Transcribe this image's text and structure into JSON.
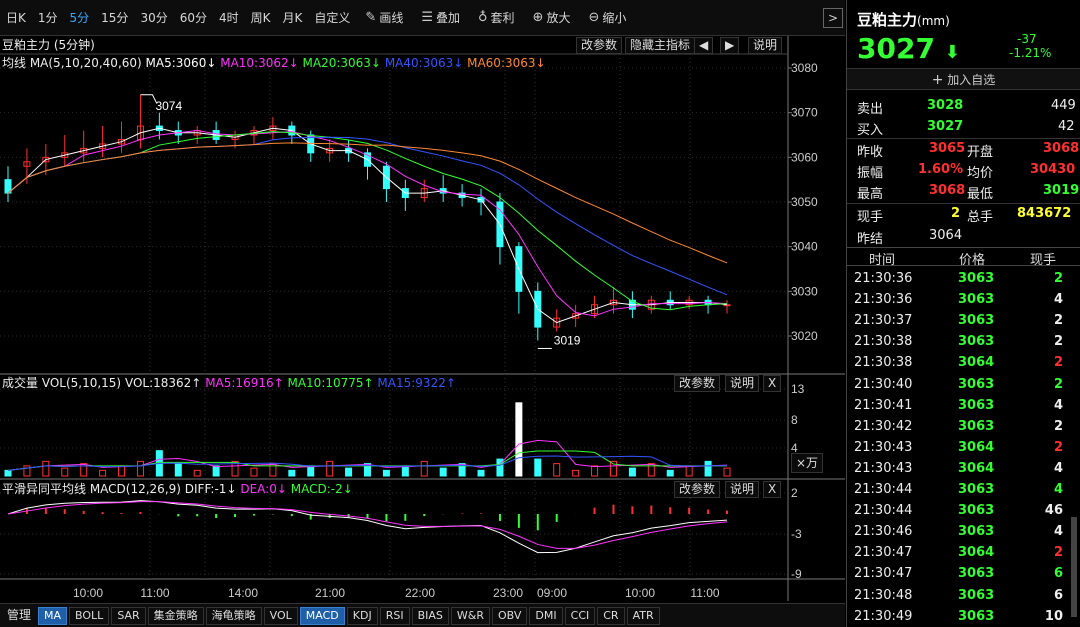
{
  "toolbar": {
    "items": [
      "日K",
      "1分",
      "5分",
      "15分",
      "30分",
      "60分",
      "4时",
      "周K",
      "月K",
      "自定义"
    ],
    "active": "5分",
    "tools": [
      {
        "icon": "pencil-icon",
        "label": "画线"
      },
      {
        "icon": "layers-icon",
        "label": "叠加"
      },
      {
        "icon": "moneybag-icon",
        "label": "套利"
      },
      {
        "icon": "zoom-in-icon",
        "label": "放大"
      },
      {
        "icon": "zoom-out-icon",
        "label": "缩小"
      }
    ],
    "more": ">"
  },
  "main_panel": {
    "title": "豆粕主力 (5分钟)",
    "btn_params": "改参数",
    "btn_hide": "隐藏主指标",
    "btn_left": "◀",
    "btn_right": "▶",
    "btn_help": "说明",
    "ma_label": "均线 MA(5,10,20,40,60)",
    "ma5": "MA5:3060↓",
    "ma10": "MA10:3062↓",
    "ma20": "MA20:3063↓",
    "ma40": "MA40:3063↓",
    "ma60": "MA60:3063↓",
    "high_label": "3074",
    "low_label": "3019"
  },
  "vol_panel": {
    "title": "成交量 VOL(5,10,15)",
    "vol": "VOL:18362↑",
    "ma5": "MA5:16916↑",
    "ma10": "MA10:10775↑",
    "ma15": "MA15:9322↑",
    "btn_params": "改参数",
    "btn_help": "说明",
    "btn_close": "X",
    "unit": "×万"
  },
  "macd_panel": {
    "title": "平滑异同平均线 MACD(12,26,9)",
    "diff": "DIFF:-1↓",
    "dea": "DEA:0↓",
    "macd": "MACD:-2↓",
    "btn_params": "改参数",
    "btn_help": "说明",
    "btn_close": "X"
  },
  "axes": {
    "price_ticks": [
      "3080",
      "3070",
      "3060",
      "3050",
      "3040",
      "3030",
      "3020"
    ],
    "vol_ticks": [
      "13",
      "8",
      "4"
    ],
    "macd_ticks": [
      "2",
      "-3",
      "-9"
    ],
    "time_labels": [
      "10:00",
      "11:00",
      "14:00",
      "21:00",
      "22:00",
      "23:00",
      "09:00",
      "10:00",
      "11:00"
    ]
  },
  "bottombar": {
    "items": [
      "管理",
      "MA",
      "BOLL",
      "SAR",
      "集金策略",
      "海龟策略",
      "VOL",
      "MACD",
      "KDJ",
      "RSI",
      "BIAS",
      "W&R",
      "OBV",
      "DMI",
      "CCI",
      "CR",
      "ATR"
    ],
    "active": [
      "MA",
      "MACD"
    ]
  },
  "quote": {
    "name": "豆粕主力",
    "unit": "(mm)",
    "price": "3027",
    "arrow": "⬇",
    "change": "-37",
    "change_pct": "-1.21%",
    "add_watch": "加入自选",
    "sell_label": "卖出",
    "sell_price": "3028",
    "sell_vol": "449",
    "buy_label": "买入",
    "buy_price": "3027",
    "buy_vol": "42",
    "prev_close_label": "昨收",
    "prev_close": "3065",
    "open_label": "开盘",
    "open": "3068",
    "amp_label": "振幅",
    "amp": "1.60%",
    "avg_label": "均价",
    "avg": "30430",
    "high_label": "最高",
    "high": "3068",
    "low_label": "最低",
    "low": "3019",
    "cur_vol_label": "现手",
    "cur_vol": "2",
    "total_vol_label": "总手",
    "total_vol": "843672",
    "prev_settle_label": "昨结",
    "prev_settle": "3064"
  },
  "ticks_header": {
    "time": "时间",
    "price": "价格",
    "vol": "现手"
  },
  "ticks": [
    {
      "time": "21:30:36",
      "price": "3063",
      "vol": "2",
      "dir": "sell"
    },
    {
      "time": "21:30:36",
      "price": "3063",
      "vol": "4",
      "dir": "neutral"
    },
    {
      "time": "21:30:37",
      "price": "3063",
      "vol": "2",
      "dir": "neutral"
    },
    {
      "time": "21:30:38",
      "price": "3063",
      "vol": "2",
      "dir": "neutral"
    },
    {
      "time": "21:30:38",
      "price": "3064",
      "vol": "2",
      "dir": "buy"
    },
    {
      "time": "21:30:40",
      "price": "3063",
      "vol": "2",
      "dir": "sell"
    },
    {
      "time": "21:30:41",
      "price": "3063",
      "vol": "4",
      "dir": "neutral"
    },
    {
      "time": "21:30:42",
      "price": "3063",
      "vol": "2",
      "dir": "neutral"
    },
    {
      "time": "21:30:43",
      "price": "3064",
      "vol": "2",
      "dir": "buy"
    },
    {
      "time": "21:30:43",
      "price": "3064",
      "vol": "4",
      "dir": "neutral"
    },
    {
      "time": "21:30:44",
      "price": "3063",
      "vol": "4",
      "dir": "sell"
    },
    {
      "time": "21:30:44",
      "price": "3063",
      "vol": "46",
      "dir": "neutral"
    },
    {
      "time": "21:30:46",
      "price": "3063",
      "vol": "4",
      "dir": "neutral"
    },
    {
      "time": "21:30:47",
      "price": "3064",
      "vol": "2",
      "dir": "buy"
    },
    {
      "time": "21:30:47",
      "price": "3063",
      "vol": "6",
      "dir": "sell"
    },
    {
      "time": "21:30:48",
      "price": "3063",
      "vol": "6",
      "dir": "neutral"
    },
    {
      "time": "21:30:49",
      "price": "3063",
      "vol": "10",
      "dir": "neutral"
    }
  ],
  "colors": {
    "up": "#ff3030",
    "down": "#33ffff",
    "ma5": "#ffffff",
    "ma10": "#ff33ff",
    "ma20": "#33ff33",
    "ma40": "#3355ff",
    "ma60": "#ff8833",
    "diff": "#ffffff",
    "dea": "#ff33ff",
    "accent": "#38a8ff"
  },
  "chart_data": {
    "type": "candlestick",
    "price_range": [
      3018,
      3082
    ],
    "high": 3074,
    "low": 3019,
    "last": 3027,
    "ma_end": {
      "ma5": 3060,
      "ma10": 3062,
      "ma20": 3063,
      "ma40": 3063,
      "ma60": 3063
    },
    "candles_approx": [
      [
        3055,
        3058,
        3052,
        3050
      ],
      [
        3058,
        3062,
        3059,
        3054
      ],
      [
        3059,
        3063,
        3060,
        3056
      ],
      [
        3060,
        3065,
        3061,
        3058
      ],
      [
        3061,
        3066,
        3062,
        3059
      ],
      [
        3062,
        3067,
        3063,
        3060
      ],
      [
        3063,
        3068,
        3064,
        3061
      ],
      [
        3064,
        3074,
        3067,
        3062
      ],
      [
        3067,
        3070,
        3066,
        3064
      ],
      [
        3066,
        3068,
        3065,
        3063
      ],
      [
        3065,
        3067,
        3066,
        3063
      ],
      [
        3066,
        3068,
        3064,
        3063
      ],
      [
        3064,
        3066,
        3065,
        3062
      ],
      [
        3065,
        3067,
        3066,
        3063
      ],
      [
        3066,
        3069,
        3067,
        3064
      ],
      [
        3067,
        3068,
        3065,
        3063
      ],
      [
        3065,
        3066,
        3061,
        3059
      ],
      [
        3061,
        3064,
        3062,
        3059
      ],
      [
        3062,
        3064,
        3061,
        3059
      ],
      [
        3061,
        3062,
        3058,
        3055
      ],
      [
        3058,
        3059,
        3053,
        3050
      ],
      [
        3053,
        3055,
        3051,
        3048
      ],
      [
        3051,
        3055,
        3053,
        3050
      ],
      [
        3053,
        3056,
        3052,
        3050
      ],
      [
        3052,
        3054,
        3051,
        3049
      ],
      [
        3051,
        3053,
        3050,
        3047
      ],
      [
        3050,
        3052,
        3040,
        3036
      ],
      [
        3040,
        3041,
        3030,
        3025
      ],
      [
        3030,
        3032,
        3022,
        3019
      ],
      [
        3022,
        3026,
        3024,
        3021
      ],
      [
        3024,
        3027,
        3025,
        3022
      ],
      [
        3025,
        3029,
        3027,
        3024
      ],
      [
        3027,
        3031,
        3028,
        3025
      ],
      [
        3028,
        3030,
        3026,
        3024
      ],
      [
        3026,
        3029,
        3028,
        3025
      ],
      [
        3028,
        3030,
        3027,
        3026
      ],
      [
        3027,
        3029,
        3028,
        3026
      ],
      [
        3028,
        3029,
        3027,
        3025
      ],
      [
        3027,
        3028,
        3027,
        3025
      ]
    ]
  }
}
